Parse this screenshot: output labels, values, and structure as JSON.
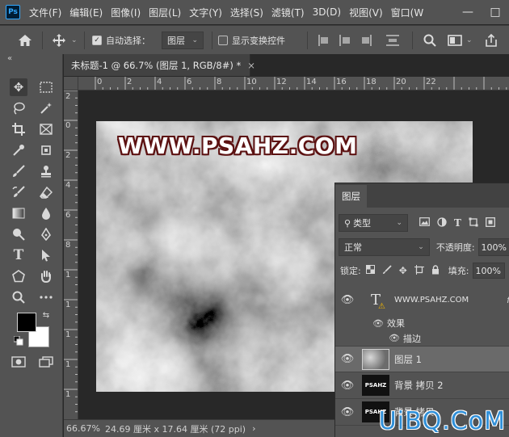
{
  "app": {
    "logo": "Ps",
    "menus": [
      "文件(F)",
      "编辑(E)",
      "图像(I)",
      "图层(L)",
      "文字(Y)",
      "选择(S)",
      "滤镜(T)",
      "3D(D)",
      "视图(V)",
      "窗口(W"
    ],
    "window_controls": {
      "minimize": "—",
      "maximize": "□"
    }
  },
  "options": {
    "auto_select_label": "自动选择：",
    "auto_select_checked": true,
    "auto_select_value": "图层",
    "show_transform_label": "显示变换控件",
    "show_transform_checked": false
  },
  "toolbox": {
    "collapse": "«"
  },
  "document": {
    "tab_title": "未标题-1 @ 66.7% (图层 1, RGB/8#) *",
    "close": "×",
    "ruler_top_labels": [
      "0",
      "2",
      "4",
      "6",
      "8",
      "10",
      "12",
      "14",
      "16",
      "18",
      "20",
      "22"
    ],
    "ruler_left_labels": [
      "2",
      "0",
      "2",
      "4",
      "6",
      "8",
      "1",
      "1",
      "1",
      "1",
      "1"
    ],
    "canvas_text": "WWW.PSAHZ.COM"
  },
  "status": {
    "zoom": "66.67%",
    "info": "24.69 厘米 x 17.64 厘米 (72 ppi)",
    "arrow": "›"
  },
  "layers_panel": {
    "tab": "图层",
    "filter_label": "类型",
    "blend_mode": "正常",
    "opacity_label": "不透明度:",
    "opacity_value": "100%",
    "lock_label": "锁定:",
    "fill_label": "填充:",
    "fill_value": "100%",
    "layers": [
      {
        "name": "WWW.PSAHZ.COM",
        "fx": "f",
        "thumb": "T"
      },
      {
        "name": "效果"
      },
      {
        "name": "描边"
      },
      {
        "name": "图层 1",
        "selected": true
      },
      {
        "name": "背景 拷贝 2",
        "thumb": "PSAHZ"
      },
      {
        "name": "背景 拷贝",
        "thumb": "PSAHZ"
      }
    ]
  },
  "site_watermark": "UiBQ.CoM"
}
